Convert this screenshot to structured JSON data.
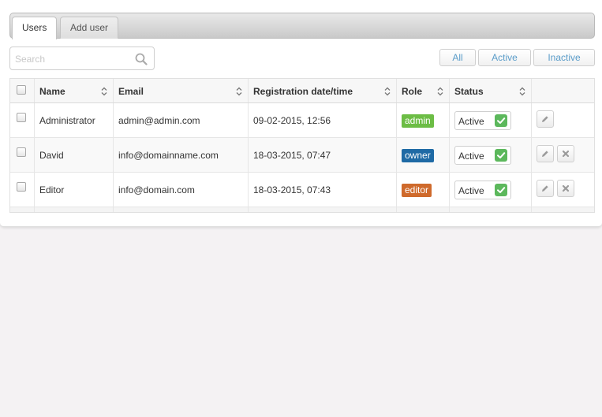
{
  "tabs": [
    {
      "label": "Users",
      "active": true
    },
    {
      "label": "Add user",
      "active": false
    }
  ],
  "search": {
    "placeholder": "Search",
    "value": ""
  },
  "filters": {
    "all": "All",
    "active": "Active",
    "inactive": "Inactive"
  },
  "table": {
    "headers": {
      "name": "Name",
      "email": "Email",
      "registration": "Registration date/time",
      "role": "Role",
      "status": "Status"
    },
    "rows": [
      {
        "name": "Administrator",
        "email": "admin@admin.com",
        "registration": "09-02-2015, 12:56",
        "role": "admin",
        "role_color": "#6cbd45",
        "status": "Active",
        "can_delete": false
      },
      {
        "name": "David",
        "email": "info@domainname.com",
        "registration": "18-03-2015, 07:47",
        "role": "owner",
        "role_color": "#1f6aa5",
        "status": "Active",
        "can_delete": true
      },
      {
        "name": "Editor",
        "email": "info@domain.com",
        "registration": "18-03-2015, 07:43",
        "role": "editor",
        "role_color": "#cf6a2c",
        "status": "Active",
        "can_delete": true
      }
    ]
  },
  "colors": {
    "accent": "#5a9cc9",
    "status_ok": "#5cb85c",
    "page_bg": "#f4f2f3"
  },
  "icons": {
    "search": "search-icon",
    "sort": "sort-icon",
    "edit": "pencil-icon",
    "delete": "close-icon",
    "ok": "checkmark-icon"
  }
}
